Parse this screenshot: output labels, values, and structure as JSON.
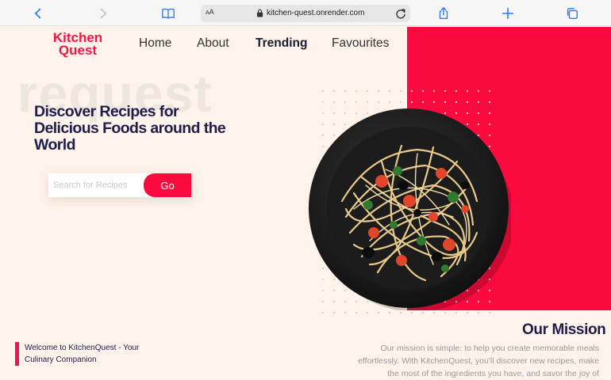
{
  "browser": {
    "url": "kitchen-quest.onrender.com",
    "text_size_label_small": "A",
    "text_size_label_large": "A"
  },
  "header": {
    "logo_line1": "Kitchen",
    "logo_line2": "Quest",
    "nav": [
      {
        "label": "Home"
      },
      {
        "label": "About"
      },
      {
        "label": "Trending"
      },
      {
        "label": "Favourites"
      }
    ]
  },
  "hero": {
    "background_word": "request",
    "headline": "Discover Recipes for Delicious Foods around the World",
    "search_placeholder": "Search for Recipes",
    "search_button": "Go"
  },
  "welcome": {
    "text": "Welcome to KitchenQuest - Your Culinary Companion"
  },
  "mission": {
    "title": "Our Mission",
    "text": "Our mission is simple: to help you create memorable meals effortlessly. With KitchenQuest, you'll discover new recipes, make the most of the ingredients you have, and savor the joy of"
  },
  "colors": {
    "accent": "#fb0a3f",
    "page_bg": "#fdf3ea",
    "heading": "#201d4b",
    "browser_blue": "#2f7cf6"
  },
  "icons": [
    "back-icon",
    "forward-icon",
    "bookmarks-icon",
    "lock-icon",
    "reload-icon",
    "share-icon",
    "new-tab-icon",
    "tabs-icon"
  ]
}
